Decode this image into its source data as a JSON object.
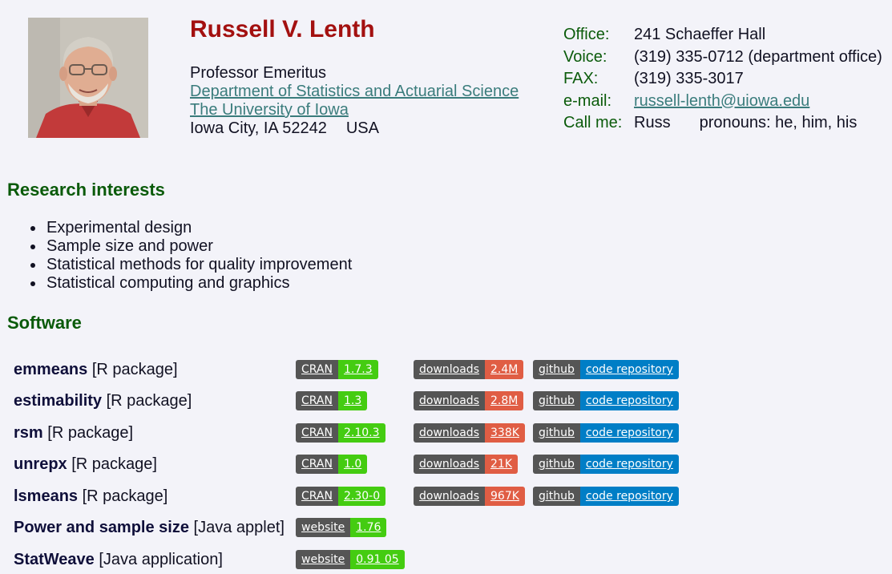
{
  "header": {
    "name": "Russell V. Lenth",
    "title": "Professor Emeritus",
    "department": "Department of Statistics and Actuarial Science",
    "university": "The University of Iowa",
    "city": "Iowa City, IA 52242",
    "country": "USA"
  },
  "contact": {
    "office_label": "Office:",
    "office": "241 Schaeffer Hall",
    "voice_label": "Voice:",
    "voice": "(319) 335-0712 (department office)",
    "fax_label": "FAX:",
    "fax": "(319) 335-3017",
    "email_label": "e-mail:",
    "email": "russell-lenth@uiowa.edu",
    "callme_label": "Call me:",
    "callme": "Russ",
    "pronouns": "pronouns: he, him, his"
  },
  "research": {
    "heading": "Research interests",
    "items": [
      "Experimental design",
      "Sample size and power",
      "Statistical methods for quality improvement",
      "Statistical computing and graphics"
    ]
  },
  "software": {
    "heading": "Software",
    "items": [
      {
        "name": "emmeans",
        "kind": "[R package]",
        "version_label": "CRAN",
        "version": "1.7.3",
        "downloads_label": "downloads",
        "downloads": "2.4M",
        "github_label": "github",
        "repo_label": "code repository"
      },
      {
        "name": "estimability",
        "kind": "[R package]",
        "version_label": "CRAN",
        "version": "1.3",
        "downloads_label": "downloads",
        "downloads": "2.8M",
        "github_label": "github",
        "repo_label": "code repository"
      },
      {
        "name": "rsm",
        "kind": "[R package]",
        "version_label": "CRAN",
        "version": "2.10.3",
        "downloads_label": "downloads",
        "downloads": "338K",
        "github_label": "github",
        "repo_label": "code repository"
      },
      {
        "name": "unrepx",
        "kind": "[R package]",
        "version_label": "CRAN",
        "version": "1.0",
        "downloads_label": "downloads",
        "downloads": "21K",
        "github_label": "github",
        "repo_label": "code repository"
      },
      {
        "name": "lsmeans",
        "kind": "[R package]",
        "version_label": "CRAN",
        "version": "2.30-0",
        "downloads_label": "downloads",
        "downloads": "967K",
        "github_label": "github",
        "repo_label": "code repository"
      },
      {
        "name": "Power and sample size",
        "kind": "[Java applet]",
        "version_label": "website",
        "version": "1.76"
      },
      {
        "name": "StatWeave",
        "kind": "[Java application]",
        "version_label": "website",
        "version": "0.91 05"
      }
    ]
  },
  "colors": {
    "name": "#a31010",
    "heading": "#0a5a0a",
    "link": "#3a7c7c",
    "badge_green": "#44cc11",
    "badge_red": "#e05d44",
    "badge_blue": "#007ec6"
  }
}
